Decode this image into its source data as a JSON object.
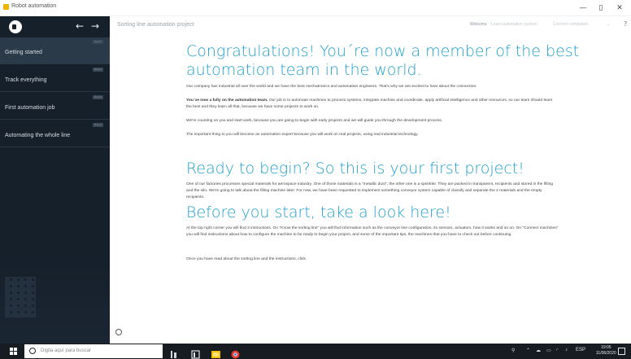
{
  "window": {
    "title": "Robot automation",
    "minimize": "—",
    "maximize": "▯",
    "close": "✕"
  },
  "sidebar": {
    "items": [
      {
        "label": "Getting started",
        "badge": "lesson",
        "active": true
      },
      {
        "label": "Track everything",
        "badge": "lesson",
        "active": false
      },
      {
        "label": "First automation job",
        "badge": "lesson",
        "active": false
      },
      {
        "label": "Automating the whole line",
        "badge": "lesson",
        "active": false
      }
    ]
  },
  "topbar": {
    "project": "Sorting line automation project",
    "links": [
      "Welcome",
      "Learn automation system",
      "Connect computers"
    ],
    "help": "?"
  },
  "content": {
    "section1": {
      "heading_line1": "Congratulations! You´re now a member of the best",
      "heading_line2": "automation team in the world.",
      "p1": "Our company has industrial all over the world and we have the best mechatronics and automation engineers. That's why we are excited to hear about the connection.",
      "p2_bold": "You´ve now a fully on the automation team.",
      "p2": "Our job is to automate machines to process systems, integrate machine and coordinate, apply artificial intelligence and other resources, so our team should learn the best and they learn all that, because we have some projects to work on.",
      "p3": "We're counting on you and start work, because you are going to begin with early projects and we will guide you through the development process.",
      "p4": "The important thing to you will become an automation expert because you will work on real projects, using real industrial technology."
    },
    "section2": {
      "heading": "Ready to begin? So this is your first project!",
      "p1": "One of our factories processes special materials for aerospace industry. One of those materials is a \"metallic dust\", the other one is a sprinkler. They are packed in transparent, recipients and stored in the filling and the silo. We're going to talk about the filling machine later. For now, we have been requested to implement something conveyor system capable of classify and separate the 2 materials and the empty recipients."
    },
    "section3": {
      "heading": "Before you start, take a look here!",
      "p1": "At the top right corner you will find 3 instructions. On \"Know the sorting line\" you will find information such as the conveyor line configuration, its sensors, actuators, how it works and so on. On \"Connect machines\" you will find instructions about how to configure the machine to be ready to begin your project, and some of the important tips, the machines that you have to check out before continuing.",
      "p2": "Once you have read about the sorting line and the instructions, click."
    }
  },
  "taskbar": {
    "search_placeholder": "Digita aquí para buscar",
    "tray_lang": "ESP",
    "time": "19:05",
    "date": "11/06/2020"
  },
  "colors": {
    "accent": "#1f9fcf",
    "sidebar_bg": "#16202b",
    "taskbar_bg": "#161c22"
  }
}
